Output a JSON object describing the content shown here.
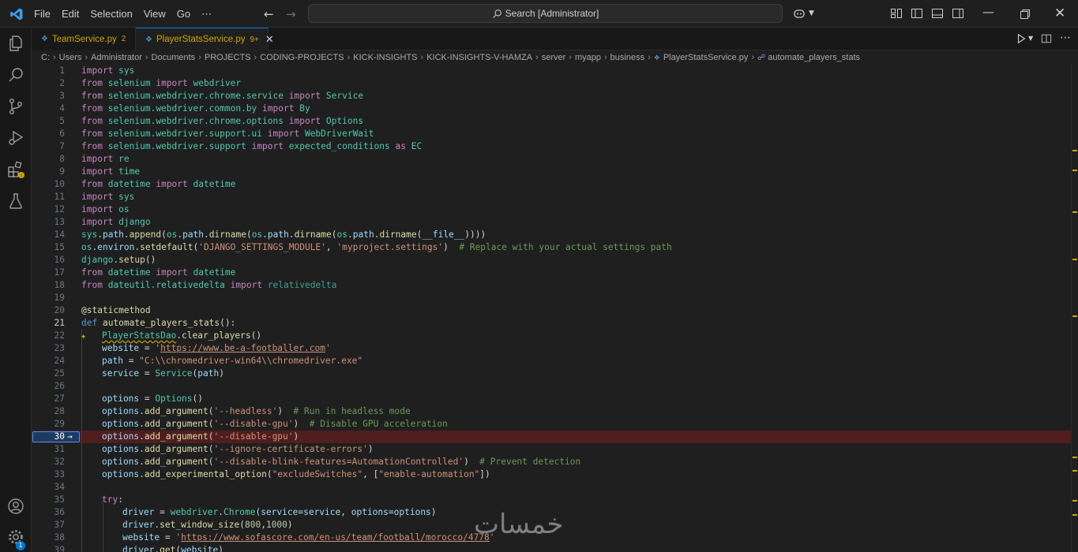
{
  "menus": [
    "File",
    "Edit",
    "Selection",
    "View",
    "Go",
    "⋯"
  ],
  "search": {
    "label": "Search [Administrator]"
  },
  "tabs": [
    {
      "name": "TeamService.py",
      "badge": "2"
    },
    {
      "name": "PlayerStatsService.py",
      "badge": "9+"
    }
  ],
  "breadcrumb": [
    "C:",
    "Users",
    "Administrator",
    "Documents",
    "PROJECTS",
    "CODING-PROJECTS",
    "KICK-INSIGHTS",
    "KICK-INSIGHTS-V-HAMZA",
    "server",
    "myapp",
    "business",
    "PlayerStatsService.py",
    "automate_players_stats"
  ],
  "editor": {
    "lines": [
      "1",
      "2",
      "3",
      "4",
      "5",
      "6",
      "7",
      "8",
      "9",
      "10",
      "11",
      "12",
      "13",
      "14",
      "15",
      "16",
      "17",
      "18",
      "19",
      "20",
      "21",
      "22",
      "23",
      "24",
      "25",
      "26",
      "27",
      "28",
      "29",
      "30",
      "31",
      "32",
      "33",
      "34",
      "35",
      "36",
      "37",
      "38",
      "39"
    ],
    "current_line": "21",
    "debug_line": "30"
  },
  "accounts_badge": "1",
  "watermark": "خمسات",
  "colors": {
    "accent": "#0078d4",
    "warning": "#cca700",
    "debug_line": "#5a1d1d"
  }
}
